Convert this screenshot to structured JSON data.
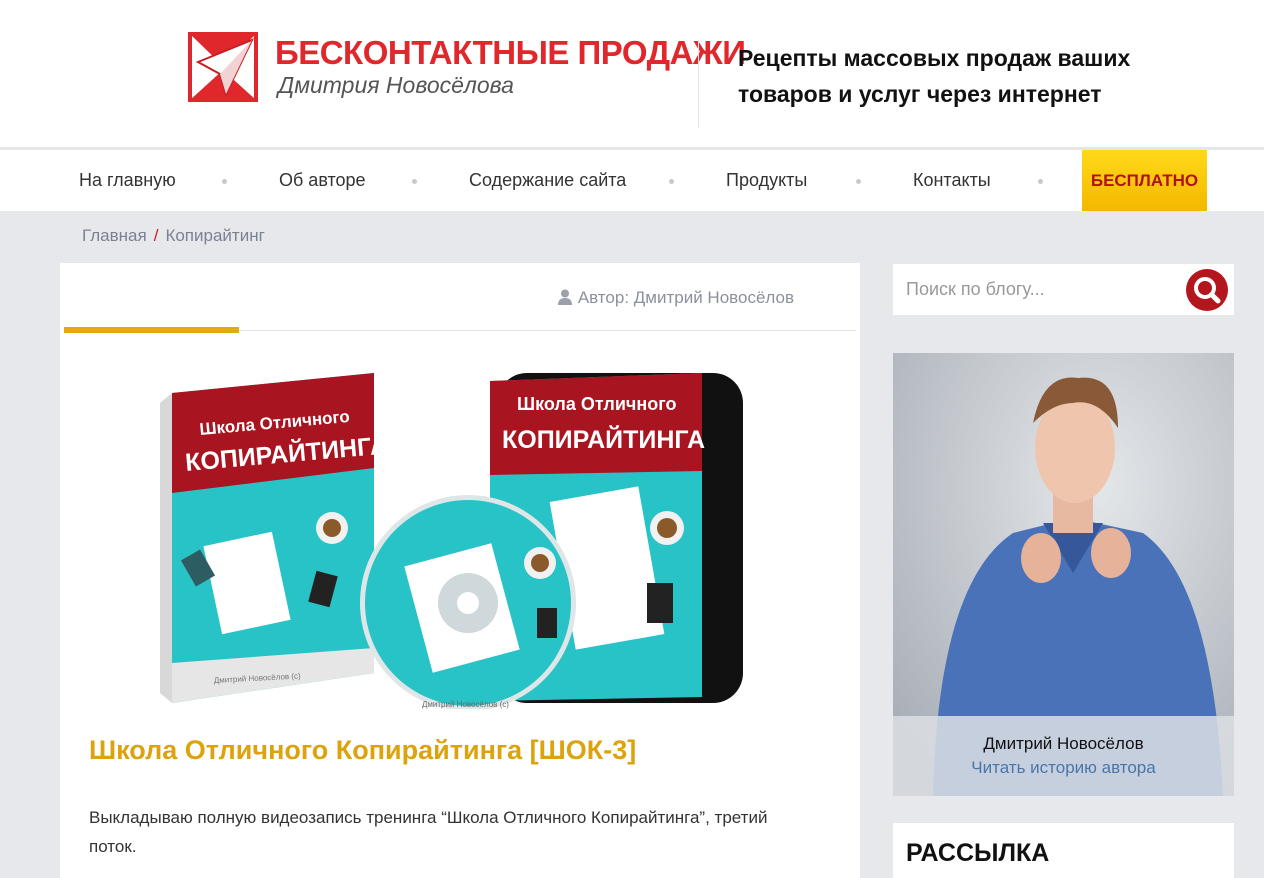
{
  "header": {
    "logo_title": "БЕСКОНТАКТНЫЕ ПРОДАЖИ",
    "logo_subtitle": "Дмитрия Новосёлова",
    "tagline": "Рецепты массовых продаж ваших товаров и услуг через интернет"
  },
  "nav": {
    "items": [
      "На главную",
      "Об авторе",
      "Содержание сайта",
      "Продукты",
      "Контакты"
    ],
    "highlight": "БЕСПЛАТНО"
  },
  "breadcrumb": {
    "home": "Главная",
    "separator": "/",
    "current": "Копирайтинг"
  },
  "post": {
    "author": "Автор: Дмитрий Новосёлов",
    "image": {
      "book_title_line1": "Школа Отличного",
      "book_title_line2": "КОПИРАЙТИНГА",
      "book_footer": "Дмитрий Новосёлов (с)",
      "box_title_line1": "Школа Отличного",
      "box_title_line2": "КОПИРАЙТИНГА",
      "disc_footer": "Дмитрий Новосёлов (с)"
    },
    "title": "Школа Отличного Копирайтинга [ШОК-3]",
    "text": "Выкладываю полную видеозапись тренинга “Школа Отличного Копирайтинга”, третий поток."
  },
  "sidebar": {
    "search_placeholder": "Поиск по блогу...",
    "author_name": "Дмитрий Новосёлов",
    "author_link": "Читать историю автора",
    "newsletter_title": "РАССЫЛКА"
  },
  "colors": {
    "brand_red": "#e0272b",
    "accent_yellow": "#dca30d",
    "search_button": "#b3161d",
    "link": "#4a76a8"
  },
  "icons": [
    "logo-envelope-icon",
    "person-icon",
    "search-icon"
  ]
}
